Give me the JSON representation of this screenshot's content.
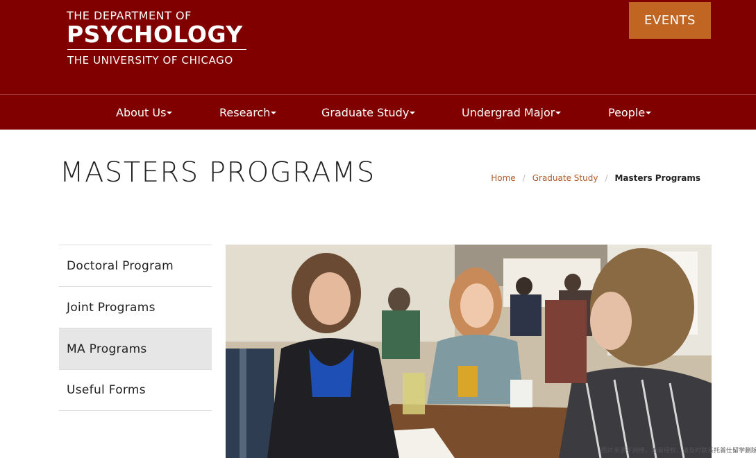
{
  "header": {
    "logo_line1": "THE DEPARTMENT OF",
    "logo_line2": "PSYCHOLOGY",
    "logo_line3": "THE UNIVERSITY OF CHICAGO",
    "events_label": "EVENTS",
    "background": "#800000",
    "events_color": "#c16622"
  },
  "nav": {
    "items": [
      {
        "label": "About Us",
        "icon": "caret-down-icon"
      },
      {
        "label": "Research",
        "icon": "caret-down-icon"
      },
      {
        "label": "Graduate Study",
        "icon": "caret-down-icon"
      },
      {
        "label": "Undergrad Major",
        "icon": "caret-down-icon"
      },
      {
        "label": "People",
        "icon": "caret-down-icon"
      }
    ]
  },
  "page": {
    "title": "MASTERS PROGRAMS"
  },
  "breadcrumb": {
    "items": [
      "Home",
      "Graduate Study"
    ],
    "separator": "/",
    "current": "Masters Programs",
    "link_color": "#b35a26"
  },
  "sidebar": {
    "items": [
      {
        "label": "Doctoral Program",
        "active": false
      },
      {
        "label": "Joint Programs",
        "active": false
      },
      {
        "label": "MA Programs",
        "active": true
      },
      {
        "label": "Useful Forms",
        "active": false
      }
    ]
  },
  "watermark": {
    "text": "图片来源于网络，如有侵权，请及时联系托普仕留学删除"
  }
}
